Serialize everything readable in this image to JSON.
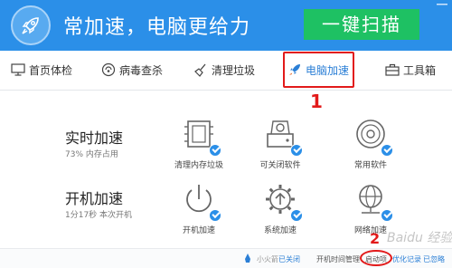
{
  "header": {
    "slogan": "常加速，电脑更给力",
    "scan_button": "一键扫描"
  },
  "tabs": [
    {
      "label": "首页体检",
      "icon": "monitor-icon"
    },
    {
      "label": "病毒查杀",
      "icon": "virus-shield-icon"
    },
    {
      "label": "清理垃圾",
      "icon": "broom-icon"
    },
    {
      "label": "电脑加速",
      "icon": "rocket-icon",
      "active": true
    },
    {
      "label": "工具箱",
      "icon": "toolbox-icon"
    }
  ],
  "annotations": {
    "step1": "1",
    "step2": "2"
  },
  "realtime": {
    "title": "实时加速",
    "subtitle": "73% 内存占用",
    "tools": [
      {
        "label": "清理内存垃圾",
        "icon": "memory-chip-icon"
      },
      {
        "label": "可关闭软件",
        "icon": "disk-drive-icon"
      },
      {
        "label": "常用软件",
        "icon": "cd-disc-icon"
      }
    ]
  },
  "startup": {
    "title": "开机加速",
    "subtitle": "1分17秒 本次开机",
    "tools": [
      {
        "label": "开机加速",
        "icon": "power-icon"
      },
      {
        "label": "系统加速",
        "icon": "gear-up-icon"
      },
      {
        "label": "网络加速",
        "icon": "globe-network-icon"
      }
    ]
  },
  "footer": {
    "rocket_label": "小火箭",
    "rocket_status": "已关闭",
    "boot_time_mgmt": "开机时间管理",
    "startup_items": "启动项",
    "optimize_log": "优化记录",
    "ignored": "已忽略"
  },
  "watermark": "Baidu 经验",
  "colors": {
    "brand_blue": "#2b8fe8",
    "scan_green": "#1ec163",
    "annotation_red": "#e21a1a",
    "link_blue": "#2b7fd6"
  }
}
